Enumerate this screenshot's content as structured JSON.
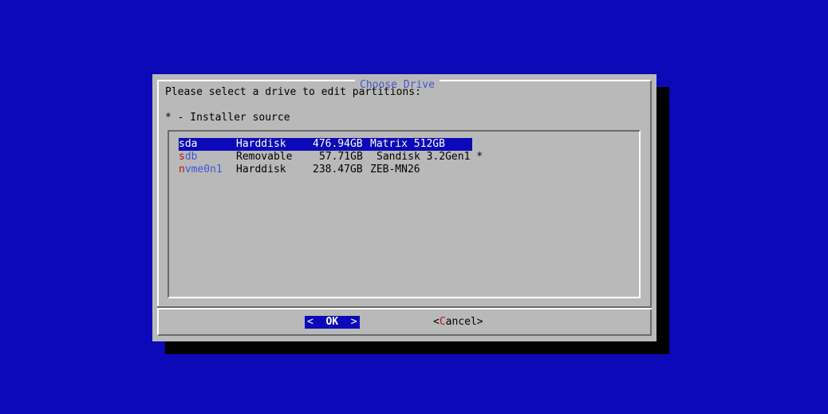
{
  "dialog": {
    "title": "Choose Drive",
    "prompt": "Please select a drive to edit partitions:",
    "legend": "* - Installer source"
  },
  "drives": [
    {
      "hotkey": "s",
      "name_rest": "da",
      "type": "Harddisk",
      "size": "476.94GB",
      "model": "Matrix 512GB",
      "selected": true
    },
    {
      "hotkey": "s",
      "name_rest": "db",
      "type": "Removable",
      "size": "57.71GB",
      "model": "Sandisk 3.2Gen1 *",
      "selected": false
    },
    {
      "hotkey": "n",
      "name_rest": "vme0n1",
      "type": "Harddisk",
      "size": "238.47GB",
      "model": "ZEB-MN26",
      "selected": false
    }
  ],
  "buttons": {
    "ok_left": "<",
    "ok_label": "OK",
    "ok_right": ">",
    "cancel_left": "<",
    "cancel_hotkey": "C",
    "cancel_rest": "ancel",
    "cancel_right": ">"
  },
  "colors": {
    "background": "#0b09b8",
    "dialog": "#b9b9b9",
    "title": "#3f57d6",
    "hotkey": "#c01010",
    "selection": "#0b09b8"
  }
}
